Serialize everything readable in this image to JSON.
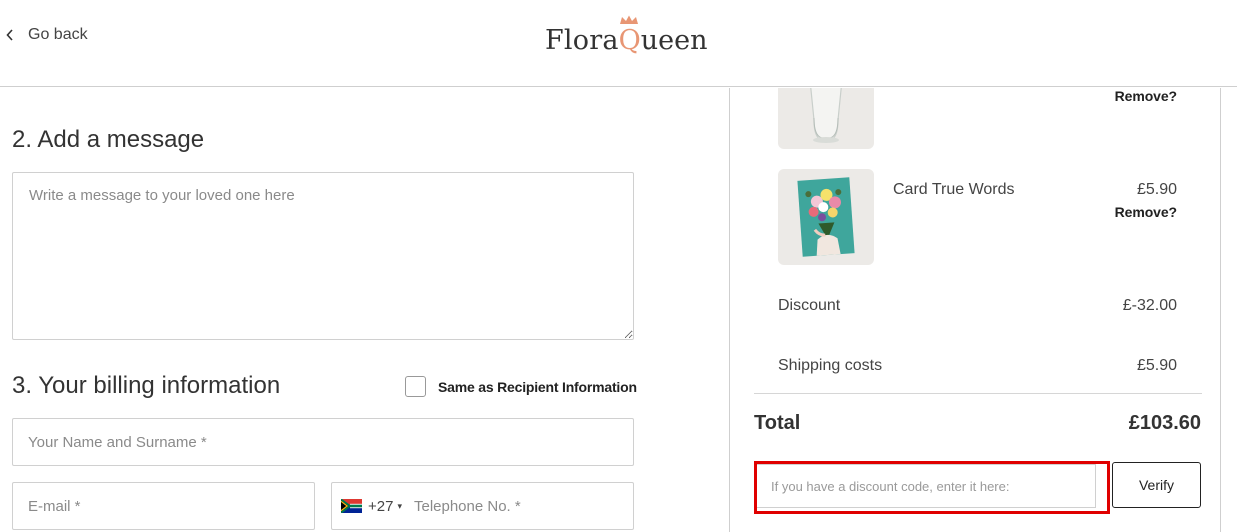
{
  "header": {
    "go_back_label": "Go back",
    "logo": {
      "part1": "Flora",
      "q": "Q",
      "part2": "ueen",
      "accent_color": "#e89674"
    }
  },
  "message_section": {
    "title": "2. Add a message",
    "placeholder": "Write a message to your loved one here",
    "value": ""
  },
  "billing_section": {
    "title": "3. Your billing information",
    "same_as_recipient_label": "Same as Recipient Information",
    "same_as_recipient_checked": false,
    "name_placeholder": "Your Name and Surname *",
    "email_placeholder": "E-mail *",
    "phone": {
      "flag_icon": "south-africa-flag-icon",
      "dial_code": "+27",
      "placeholder": "Telephone No. *"
    }
  },
  "order_summary": {
    "items": [
      {
        "name": "",
        "price": "",
        "remove_label": "Remove?",
        "thumb_icon": "glass-vase-image"
      },
      {
        "name": "Card True Words",
        "price": "£5.90",
        "remove_label": "Remove?",
        "thumb_icon": "flower-card-image"
      }
    ],
    "discount": {
      "label": "Discount",
      "value": "£-32.00"
    },
    "shipping": {
      "label": "Shipping costs",
      "value": "£5.90"
    },
    "total": {
      "label": "Total",
      "value": "£103.60"
    },
    "discount_code": {
      "placeholder": "If you have a discount code, enter it here:",
      "value": "",
      "highlight_color": "#e00000"
    },
    "verify_label": "Verify"
  }
}
